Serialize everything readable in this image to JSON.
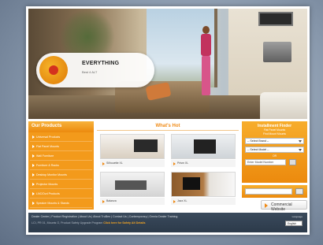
{
  "hero": {
    "promo_title": "EVERYTHING",
    "promo_subtitle": "Best 4 ALT"
  },
  "products": {
    "title": "Our Products",
    "items": [
      "Universal Products",
      "Flat Panel Mounts",
      "Wall Furniture",
      "Furniture & Racks",
      "Desktop Monitor Mounts",
      "Projector Mounts",
      "LNC/Dvd Products",
      "Speaker Mounts & Stands"
    ]
  },
  "whats_hot": {
    "title": "What's Hot",
    "tiles": [
      "Silhouette XL",
      "Prism XL",
      "Balanza",
      "Jazz XL"
    ]
  },
  "finder": {
    "title": "Installment Finder",
    "subtitle1": "Flat Panel Mounts",
    "subtitle2": "Find Mount Mounts",
    "select_brand": "-- Select Brand --",
    "select_model": "-- Select Model --",
    "or_text": "OR",
    "model_placeholder": "Enter Model Number"
  },
  "commercial_label": "Commercial Website",
  "footer": {
    "links": "Dealer Center  |  Product Registration  |  About Us  |  About TruBen  |  Contact Us  |  Contemporary  |  Omnia Dealer Training",
    "legal_prefix": "LCI, PR 01, Mounts O, Product Safety Upgrade Program ",
    "legal_highlight": "Click here for Safety Alt Details",
    "lang_label": "Language",
    "lang_value": "English"
  },
  "colors": {
    "accent": "#ec8a0d",
    "footer_bg": "#2c3a4a",
    "page_bg": "#8797ab"
  }
}
